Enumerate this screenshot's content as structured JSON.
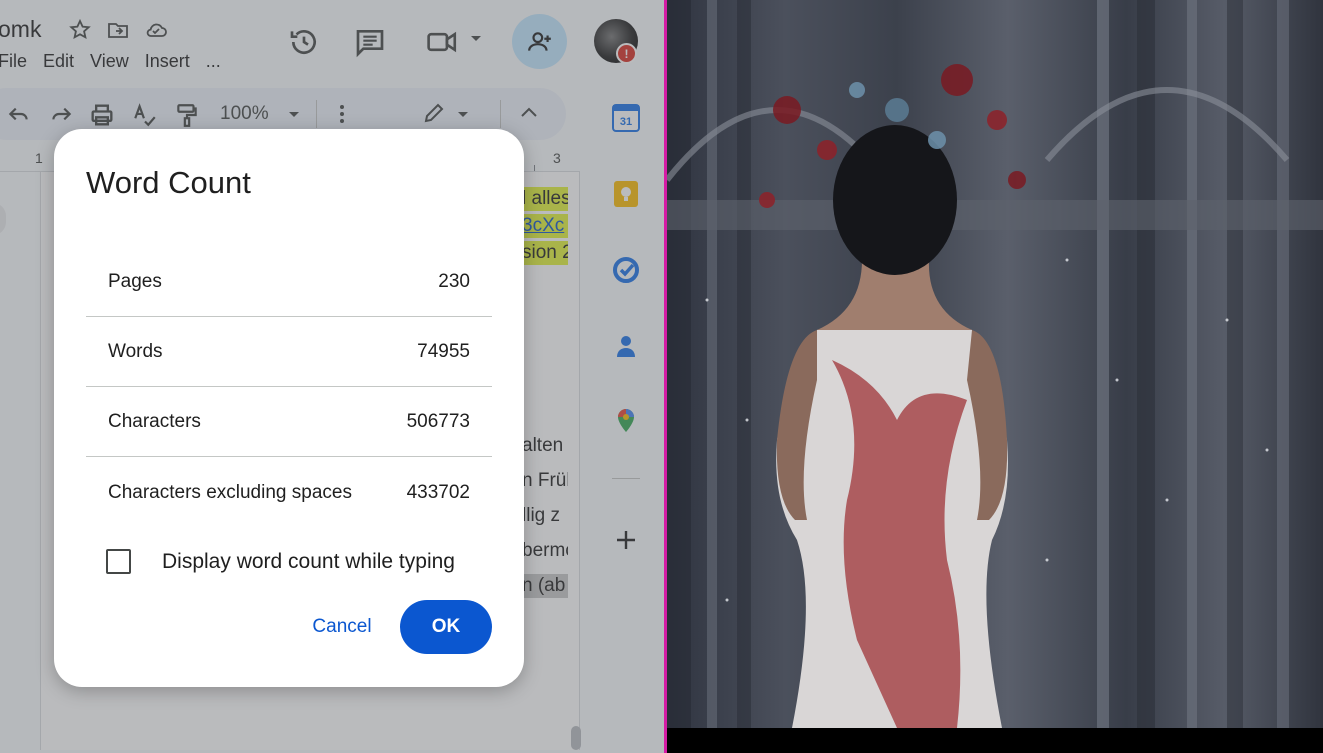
{
  "docs": {
    "title": "omk",
    "menu": [
      "File",
      "Edit",
      "View",
      "Insert",
      "..."
    ],
    "zoom": "100%",
    "ruler": [
      "1",
      "3"
    ],
    "body_snippets": [
      {
        "text": "l alles",
        "style": "hl"
      },
      {
        "text": "3cXc",
        "style": "link"
      },
      {
        "text": "sion 2",
        "style": "hl"
      },
      {
        "text": "alten",
        "style": "plain"
      },
      {
        "text": "n Früh",
        "style": "plain"
      },
      {
        "text": "llig z",
        "style": "plain"
      },
      {
        "text": "bermc",
        "style": "plain"
      },
      {
        "text": "n (ab",
        "style": "grey"
      }
    ]
  },
  "dialog": {
    "title": "Word Count",
    "stats": [
      {
        "label": "Pages",
        "value": "230"
      },
      {
        "label": "Words",
        "value": "74955"
      },
      {
        "label": "Characters",
        "value": "506773"
      },
      {
        "label": "Characters excluding spaces",
        "value": "433702"
      }
    ],
    "checkbox_label": "Display word count while typing",
    "checkbox_checked": false,
    "cancel_label": "Cancel",
    "ok_label": "OK"
  },
  "colors": {
    "accent": "#0b57d0",
    "share_bg": "#c2e7ff",
    "divider": "#d61ca5",
    "highlight": "#e2f33a"
  },
  "calendar_day": "31",
  "avatar_badge": "!"
}
